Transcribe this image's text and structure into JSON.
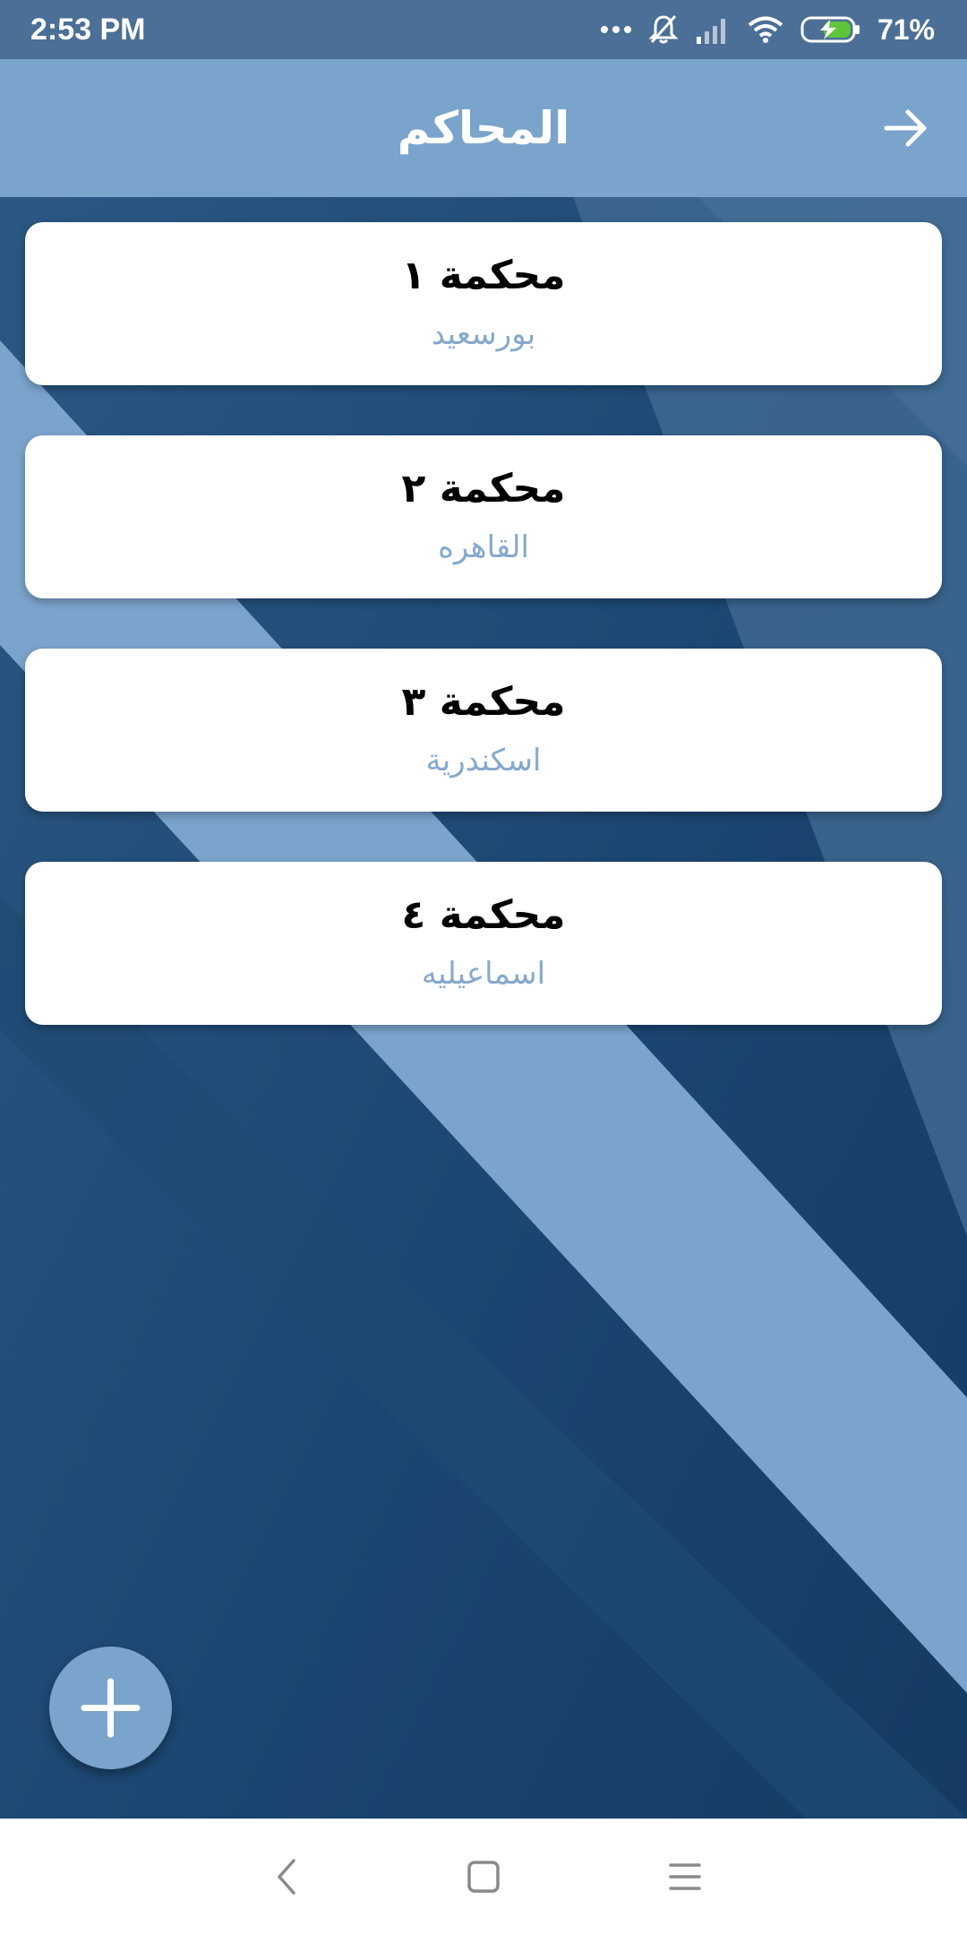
{
  "status_bar": {
    "time": "2:53 PM",
    "battery_percent": "71%",
    "icons": [
      "more-dots-icon",
      "bell-muted-icon",
      "signal-icon",
      "wifi-icon",
      "battery-charging-icon"
    ]
  },
  "app_bar": {
    "title": "المحاكم",
    "action_icon": "arrow-right-icon"
  },
  "courts": [
    {
      "name": "محكمة ١",
      "city": "بورسعيد"
    },
    {
      "name": "محكمة ٢",
      "city": "القاهره"
    },
    {
      "name": "محكمة ٣",
      "city": "اسكندرية"
    },
    {
      "name": "محكمة ٤",
      "city": "اسماعيليه"
    }
  ],
  "fab": {
    "icon": "plus-icon"
  },
  "nav_bar": {
    "icons": [
      "back-nav-icon",
      "home-nav-icon",
      "menu-nav-icon"
    ]
  },
  "colors": {
    "status_bar": "#4b6f96",
    "app_bar": "#7ba4cc",
    "background_dark": "#173f64",
    "background_stripe": "#7ba4cc",
    "card_subtitle": "#86a9cd",
    "battery_fill": "#5fc43a"
  }
}
